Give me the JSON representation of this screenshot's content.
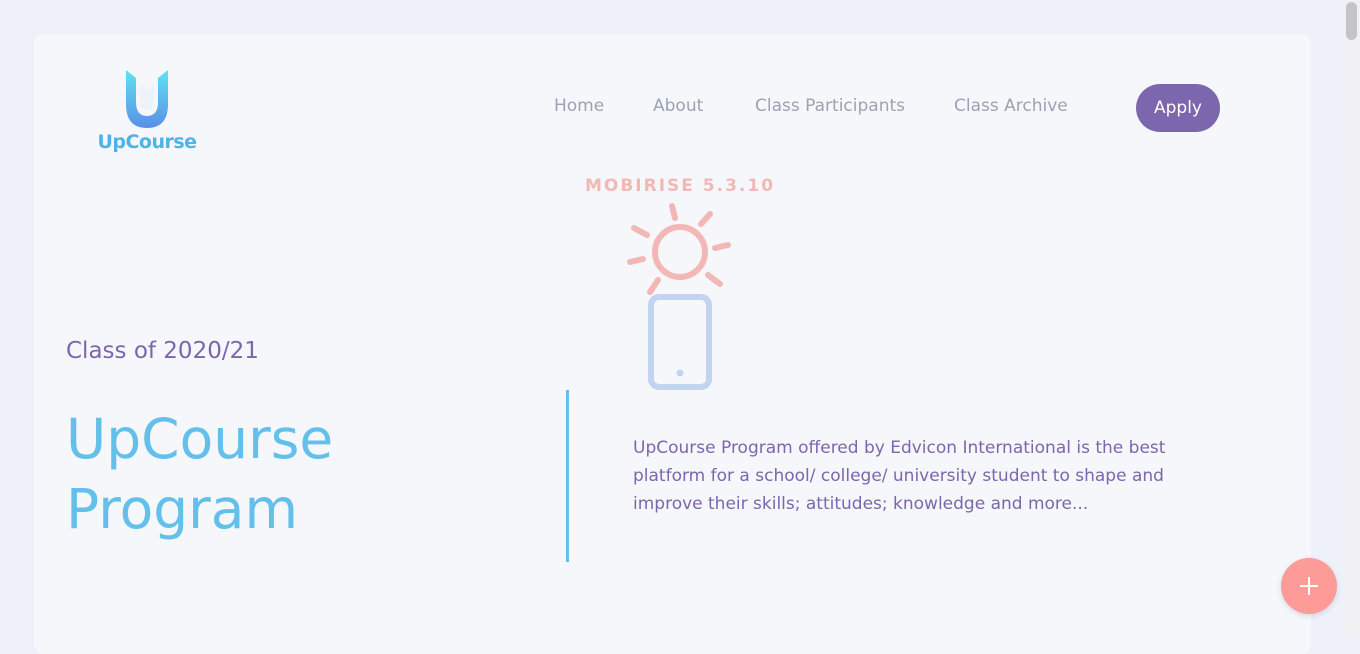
{
  "brand": {
    "name": "UpCourse"
  },
  "nav": {
    "items": [
      {
        "label": "Home"
      },
      {
        "label": "About"
      },
      {
        "label": "Class Participants"
      },
      {
        "label": "Class Archive"
      }
    ],
    "apply_label": "Apply"
  },
  "watermark": "MOBIRISE  5.3.10",
  "hero": {
    "subtitle": "Class of 2020/21",
    "title": "UpCourse Program",
    "description": "UpCourse Program offered by Edvicon International is the best platform for a school/ college/ university student to shape and improve their skills; attitudes; knowledge and more..."
  },
  "icons": {
    "logo": "upcourse-logo-icon",
    "sun": "sun-icon",
    "phone": "mobile-phone-icon",
    "fab": "plus-icon"
  },
  "colors": {
    "accent": "#7c66ad",
    "title": "#63c0ea",
    "fab": "#fc9b98",
    "watermark": "#f3b8b5"
  }
}
